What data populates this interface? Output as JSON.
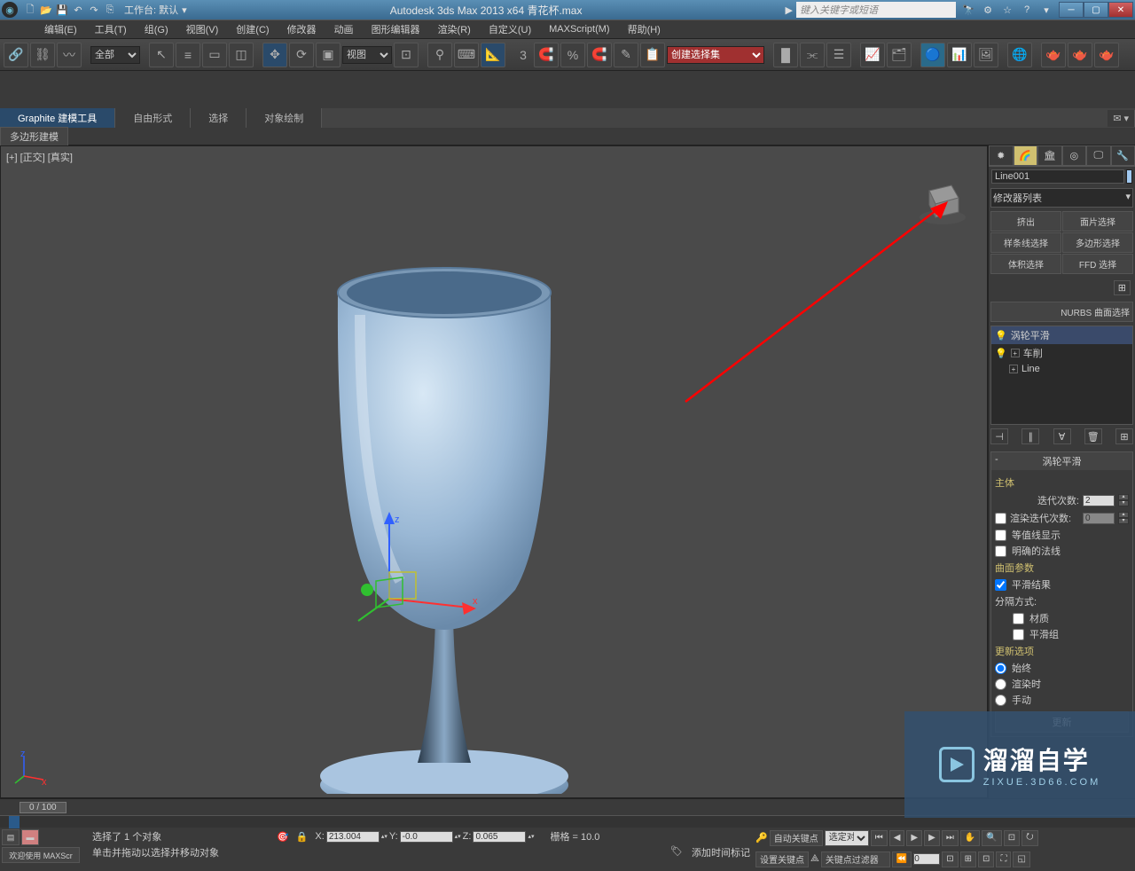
{
  "titlebar": {
    "workspace_label": "工作台: 默认",
    "app_title": "Autodesk 3ds Max  2013 x64     青花杯.max",
    "search_placeholder": "键入关键字或短语"
  },
  "menu": {
    "items": [
      "编辑(E)",
      "工具(T)",
      "组(G)",
      "视图(V)",
      "创建(C)",
      "修改器",
      "动画",
      "图形编辑器",
      "渲染(R)",
      "自定义(U)",
      "MAXScript(M)",
      "帮助(H)"
    ]
  },
  "toolbar": {
    "filter_dd": "全部",
    "view_dd": "视图",
    "named_sel_dd": "创建选择集"
  },
  "ribbon": {
    "tabs": [
      "Graphite 建模工具",
      "自由形式",
      "选择",
      "对象绘制"
    ],
    "sub": "多边形建模"
  },
  "viewport": {
    "label": "[+] [正交] [真实]"
  },
  "cmd": {
    "object_name": "Line001",
    "modifier_dd": "修改器列表",
    "mod_buttons": [
      "挤出",
      "面片选择",
      "样条线选择",
      "多边形选择",
      "体积选择",
      "FFD 选择"
    ],
    "extra_btn": "NURBS 曲面选择",
    "stack": [
      {
        "icon": "💡",
        "label": "涡轮平滑",
        "sel": true
      },
      {
        "icon": "💡",
        "exp": "+",
        "label": "车削",
        "sel": false
      },
      {
        "icon": "",
        "exp": "+",
        "label": "Line",
        "sel": false
      }
    ],
    "rollout1": {
      "title": "涡轮平滑",
      "main_label": "主体",
      "iter_label": "迭代次数:",
      "iter_val": "2",
      "render_iter_label": "渲染迭代次数:",
      "render_iter_val": "0",
      "isoline": "等值线显示",
      "explicit": "明确的法线",
      "surf_params": "曲面参数",
      "smooth_result": "平滑结果",
      "sep_by": "分隔方式:",
      "material": "材质",
      "smooth_group": "平滑组",
      "update_opts": "更新选项",
      "opt_always": "始终",
      "opt_render": "渲染时",
      "opt_manual": "手动",
      "update_btn": "更新"
    }
  },
  "timeline": {
    "frame": "0 / 100"
  },
  "status": {
    "selected": "选择了 1 个对象",
    "hint": "单击并拖动以选择并移动对象",
    "x_label": "X:",
    "x_val": "213.004",
    "y_label": "Y:",
    "y_val": "-0.0",
    "z_label": "Z:",
    "z_val": "0.065",
    "grid": "栅格 = 10.0",
    "autokey": "自动关键点",
    "selset": "选定对",
    "setkey": "设置关键点",
    "keyfilter": "关键点过滤器",
    "addtime": "添加时间标记",
    "welcome": "欢迎使用  MAXScr"
  },
  "watermark": {
    "big": "溜溜自学",
    "small": "ZIXUE.3D66.COM"
  }
}
